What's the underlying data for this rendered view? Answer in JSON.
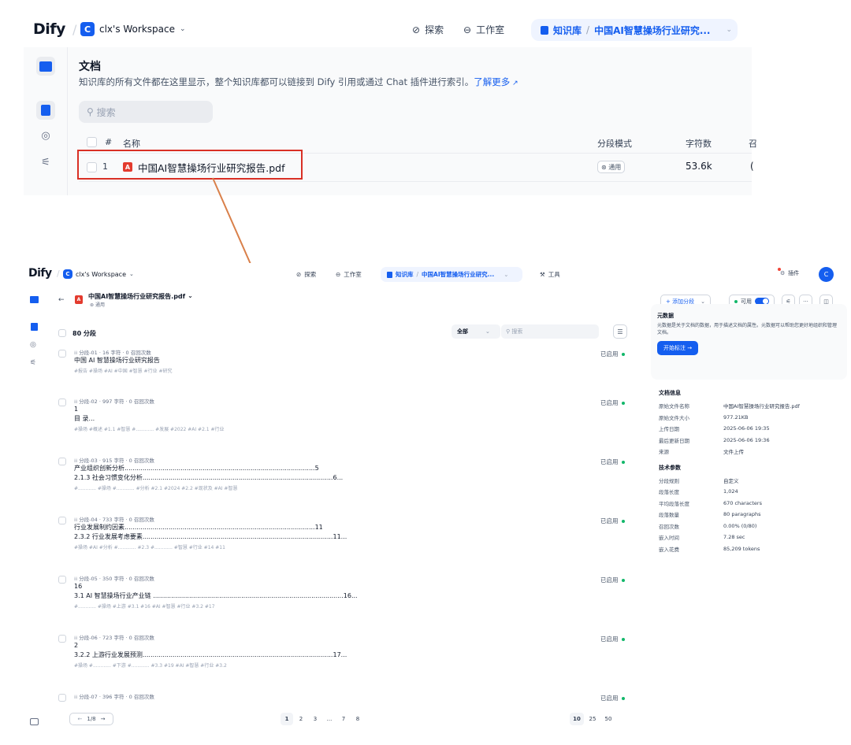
{
  "top": {
    "logo": "Dify",
    "workspace_initial": "C",
    "workspace_name": "clx's Workspace",
    "nav": {
      "explore": "探索",
      "studio": "工作室",
      "knowledge": "知识库",
      "dataset": "中国AI智慧操场行业研究..."
    },
    "page_title": "文档",
    "page_desc": "知识库的所有文件都在这里显示，整个知识库都可以链接到 Dify 引用或通过 Chat 插件进行索引。",
    "learn_more": "了解更多",
    "search_placeholder": "搜索",
    "columns": {
      "num": "#",
      "name": "名称",
      "mode": "分段模式",
      "chars": "字符数",
      "extra": "召"
    },
    "row": {
      "num": "1",
      "name": "中国AI智慧操场行业研究报告.pdf",
      "mode": "通用",
      "chars": "53.6k",
      "extra": "("
    }
  },
  "bottom": {
    "logo": "Dify",
    "workspace_initial": "C",
    "workspace_name": "clx's Workspace",
    "nav": {
      "explore": "探索",
      "studio": "工作室",
      "knowledge": "知识库",
      "dataset": "中国AI智慧操场行业研究...",
      "tools": "工具"
    },
    "plugin_label": "插件",
    "avatar": "C",
    "doc_title": "中国AI智慧操场行业研究报告.pdf",
    "doc_mode": "通用",
    "add_segment": "+ 添加分段",
    "available": "可用",
    "segment_count": "80 分段",
    "filter_all": "全部",
    "search_placeholder": "搜索",
    "enabled_label": "已启用",
    "segments": [
      {
        "meta": "分段-01 · 16 字符 · 0 召回次数",
        "lines": [
          "中国 AI 智慧操场行业研究报告"
        ],
        "tags": "#报告 #操场 #AI #中国 #智慧 #行业 #研究"
      },
      {
        "meta": "分段-02 · 997 字符 · 0 召回次数",
        "lines": [
          "1",
          "目 录..."
        ],
        "tags": "#操场 #概述 #1.1 #智慧 #............ #发展 #2022 #AI #2.1 #行业"
      },
      {
        "meta": "分段-03 · 915 字符 · 0 召回次数",
        "lines": [
          "产业组织创新分析...............................................................................................5",
          "2.1.3 社会习惯变化分析...............................................................................................6..."
        ],
        "tags": "#............ #操场 #............ #分析 #2.1 #2024 #2.2 #现状及 #AI #智慧"
      },
      {
        "meta": "分段-04 · 733 字符 · 0 召回次数",
        "lines": [
          "行业发展制约因素...............................................................................................11",
          "2.3.2 行业发展考虑要素...............................................................................................11..."
        ],
        "tags": "#操场 #AI #分析 #............ #2.3 #............ #智慧 #行业 #14 #11"
      },
      {
        "meta": "分段-05 · 350 字符 · 0 召回次数",
        "lines": [
          "16",
          "3.1 AI 智慧操场行业产业链 ...............................................................................................16..."
        ],
        "tags": "#............ #操场 #上游 #3.1 #16 #AI #智慧 #行业 #3.2 #17"
      },
      {
        "meta": "分段-06 · 723 字符 · 0 召回次数",
        "lines": [
          "2",
          "3.2.2 上游行业发展预测...............................................................................................17..."
        ],
        "tags": "#操场 #............ #下游 #............ #3.3 #19 #AI #智慧 #行业 #3.2"
      },
      {
        "meta": "分段-07 · 396 字符 · 0 召回次数",
        "lines": [],
        "tags": ""
      }
    ],
    "pager": {
      "page": "1/8",
      "pages": [
        "1",
        "2",
        "3",
        "...",
        "7",
        "8"
      ],
      "sizes": [
        "10",
        "25",
        "50"
      ]
    },
    "metadata": {
      "title": "元数据",
      "desc": "元数据是关于文档的数据，用于描述文档的属性。元数据可以帮助您更好地组织和管理文档。",
      "button": "开始标注 →"
    },
    "doc_info": {
      "title": "文档信息",
      "rows": [
        {
          "k": "原始文件名称",
          "v": "中国AI智慧操场行业研究报告.pdf"
        },
        {
          "k": "原始文件大小",
          "v": "977.21KB"
        },
        {
          "k": "上传日期",
          "v": "2025-06-06 19:35"
        },
        {
          "k": "最后更新日期",
          "v": "2025-06-06 19:36"
        },
        {
          "k": "来源",
          "v": "文件上传"
        }
      ]
    },
    "tech": {
      "title": "技术参数",
      "rows": [
        {
          "k": "分段规则",
          "v": "自定义"
        },
        {
          "k": "段落长度",
          "v": "1,024"
        },
        {
          "k": "平均段落长度",
          "v": "670 characters"
        },
        {
          "k": "段落数量",
          "v": "80 paragraphs"
        },
        {
          "k": "召回次数",
          "v": "0.00% (0/80)"
        },
        {
          "k": "嵌入时间",
          "v": "7.28 sec"
        },
        {
          "k": "嵌入花费",
          "v": "85,209 tokens"
        }
      ]
    }
  }
}
